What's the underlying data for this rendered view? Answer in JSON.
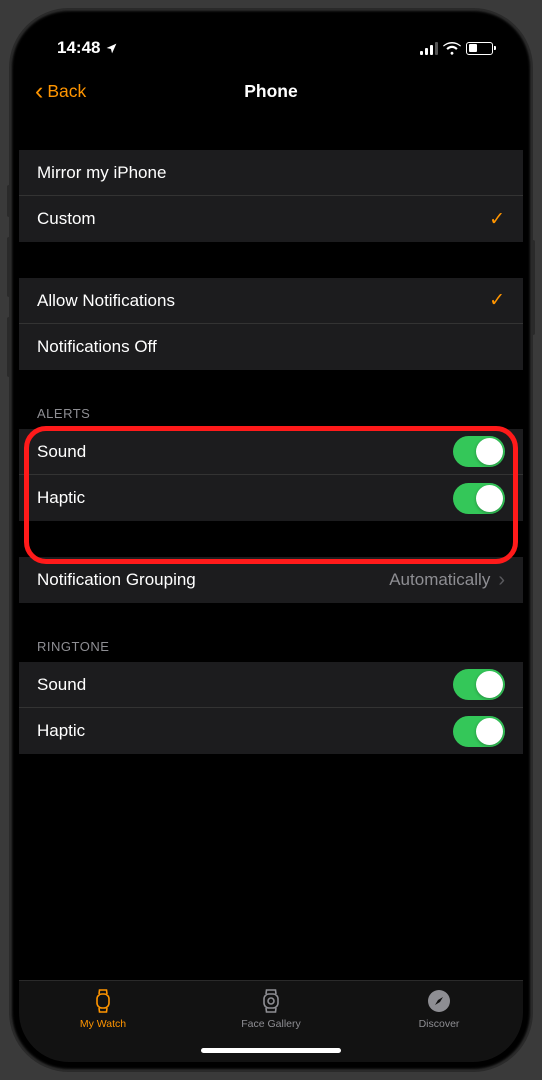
{
  "status_bar": {
    "time": "14:48",
    "location_icon": "location-arrow"
  },
  "nav": {
    "back_label": "Back",
    "title": "Phone"
  },
  "sections": {
    "mirror": {
      "items": [
        {
          "label": "Mirror my iPhone",
          "selected": false
        },
        {
          "label": "Custom",
          "selected": true
        }
      ]
    },
    "notifications": {
      "items": [
        {
          "label": "Allow Notifications",
          "selected": true
        },
        {
          "label": "Notifications Off",
          "selected": false
        }
      ]
    },
    "alerts": {
      "header": "ALERTS",
      "items": [
        {
          "label": "Sound",
          "enabled": true
        },
        {
          "label": "Haptic",
          "enabled": true
        }
      ]
    },
    "grouping": {
      "label": "Notification Grouping",
      "value": "Automatically"
    },
    "ringtone": {
      "header": "RINGTONE",
      "items": [
        {
          "label": "Sound",
          "enabled": true
        },
        {
          "label": "Haptic",
          "enabled": true
        }
      ]
    }
  },
  "tab_bar": {
    "items": [
      {
        "label": "My Watch",
        "active": true
      },
      {
        "label": "Face Gallery",
        "active": false
      },
      {
        "label": "Discover",
        "active": false
      }
    ]
  }
}
